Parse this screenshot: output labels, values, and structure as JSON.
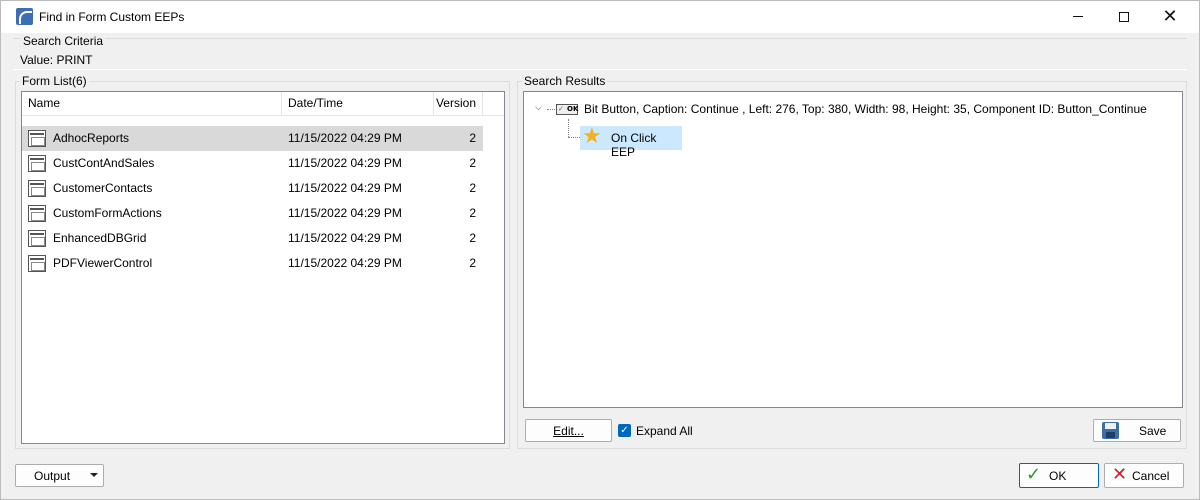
{
  "window": {
    "title": "Find in Form Custom EEPs",
    "icons": [
      "app-icon",
      "minimize-icon",
      "maximize-icon",
      "close-icon"
    ]
  },
  "search_criteria": {
    "title": "Search Criteria",
    "value_label": "Value: PRINT"
  },
  "form_list": {
    "title": "Form List(6)",
    "columns": [
      "Name",
      "Date/Time",
      "Version"
    ],
    "rows": [
      {
        "name": "AdhocReports",
        "datetime": "11/15/2022 04:29 PM",
        "version": "2",
        "selected": true
      },
      {
        "name": "CustContAndSales",
        "datetime": "11/15/2022 04:29 PM",
        "version": "2"
      },
      {
        "name": "CustomerContacts",
        "datetime": "11/15/2022 04:29 PM",
        "version": "2"
      },
      {
        "name": "CustomFormActions",
        "datetime": "11/15/2022 04:29 PM",
        "version": "2"
      },
      {
        "name": "EnhancedDBGrid",
        "datetime": "11/15/2022 04:29 PM",
        "version": "2"
      },
      {
        "name": "PDFViewerControl",
        "datetime": "11/15/2022 04:29 PM",
        "version": "2"
      }
    ]
  },
  "search_results": {
    "title": "Search Results",
    "tree": {
      "root_label": "Bit Button, Caption: Continue , Left: 276, Top: 380, Width: 98, Height: 35, Component ID: Button_Continue",
      "child_label": "On Click EEP"
    },
    "edit_button": "Edit...",
    "expand_all_label": "Expand All",
    "expand_all_checked": true,
    "save_button": "Save"
  },
  "footer": {
    "output_button": "Output",
    "ok_button": "OK",
    "cancel_button": "Cancel"
  },
  "colors": {
    "selection_row": "#d9d9d9",
    "tree_highlight": "#cce8ff",
    "accent": "#0067c0"
  }
}
